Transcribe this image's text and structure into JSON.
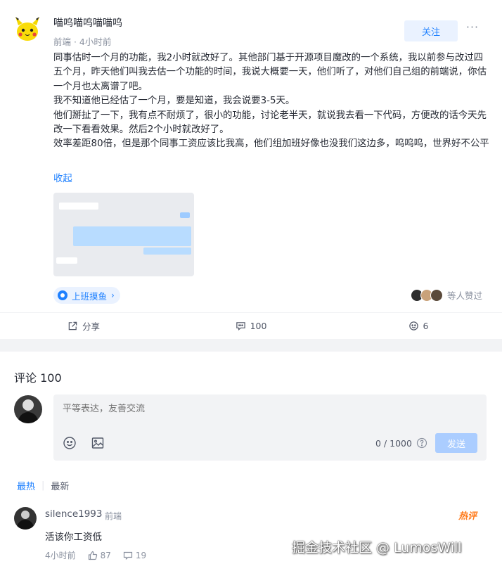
{
  "post": {
    "author": "喵呜喵呜喵喵呜",
    "meta": "前端 · 4小时前",
    "follow_label": "关注",
    "more_icon": "more-dots-icon",
    "paragraphs": [
      "同事估时一个月的功能，我2小时就改好了。其他部门基于开源项目魔改的一个系统，我以前参与改过四五个月，昨天他们叫我去估一个功能的时间，我说大概要一天，他们听了，对他们自己组的前端说，你估一个月也太离谱了吧。",
      "我不知道他已经估了一个月，要是知道，我会说要3-5天。",
      "他们掰扯了一下，我有点不耐烦了，很小的功能，讨论老半天，就说我去看一下代码，方便改的话今天先改一下看看效果。然后2个小时就改好了。",
      "效率差距80倍，但是那个同事工资应该比我高，他们组加班好像也没我们这边多，呜呜呜，世界好不公平"
    ],
    "collapse_label": "收起",
    "topic_label": "上班摸鱼",
    "likers_text": "等人赞过",
    "actions": {
      "share_label": "分享",
      "comment_count": "100",
      "like_count": "6"
    }
  },
  "comments": {
    "title": "评论 100",
    "editor_placeholder": "平等表达，友善交流",
    "char_count": "0 / 1000",
    "send_label": "发送",
    "sort_hot": "最热",
    "sort_new": "最新",
    "items": [
      {
        "name": "silence1993",
        "role": "前端",
        "badge": "热评",
        "text": "活该你工资低",
        "time": "4小时前",
        "likes": "87",
        "replies": "19"
      }
    ]
  },
  "watermark": "掘金技术社区 @ LumosWill",
  "colors": {
    "accent": "#1e80ff",
    "text": "#252933",
    "muted": "#8a919f",
    "hot": "#ff7a1a"
  }
}
